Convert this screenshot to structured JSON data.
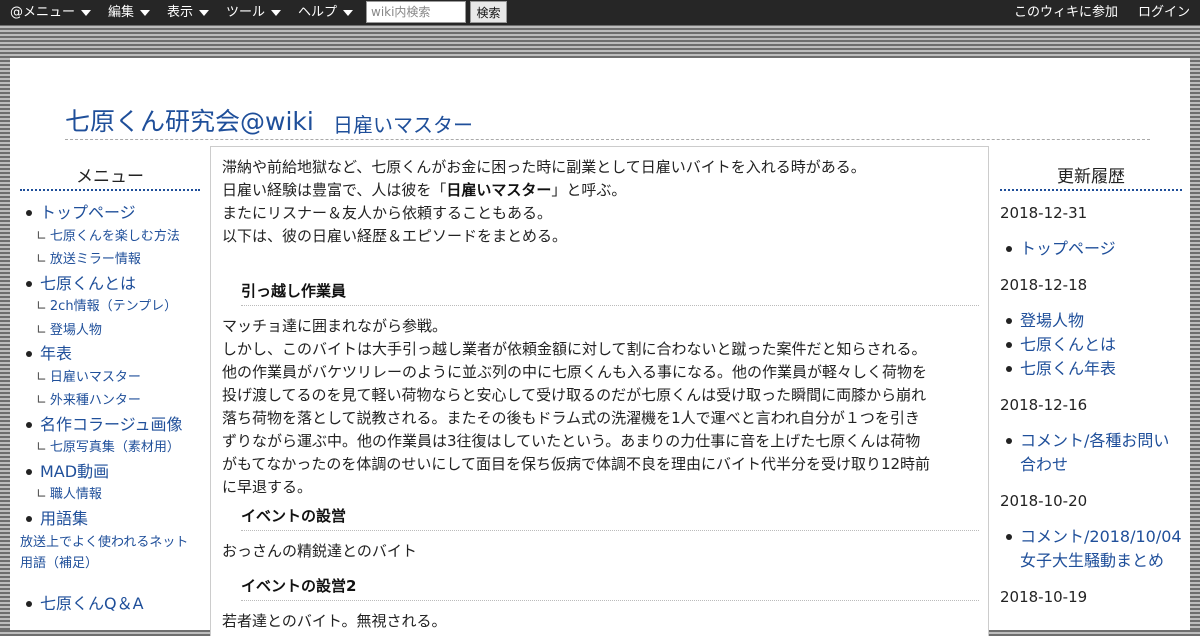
{
  "topbar": {
    "menus": [
      "@メニュー",
      "編集",
      "表示",
      "ツール",
      "ヘルプ"
    ],
    "search_placeholder": "wiki内検索",
    "search_button": "検索",
    "join_link": "このウィキに参加",
    "login_link": "ログイン"
  },
  "header": {
    "site_title": "七原くん研究会@wiki",
    "page_title": "日雇いマスター"
  },
  "left_menu": {
    "heading": "メニュー",
    "items": [
      {
        "level": 1,
        "label": "トップページ"
      },
      {
        "level": 2,
        "label": "七原くんを楽しむ方法"
      },
      {
        "level": 2,
        "label": "放送ミラー情報"
      },
      {
        "level": 1,
        "label": "七原くんとは"
      },
      {
        "level": 2,
        "label": "2ch情報（テンプレ）"
      },
      {
        "level": 2,
        "label": "登場人物"
      },
      {
        "level": 1,
        "label": "年表"
      },
      {
        "level": 2,
        "label": "日雇いマスター"
      },
      {
        "level": 2,
        "label": "外来種ハンター"
      },
      {
        "level": 1,
        "label": "名作コラージュ画像"
      },
      {
        "level": 2,
        "label": "七原写真集（素材用）"
      },
      {
        "level": 1,
        "label": "MAD動画"
      },
      {
        "level": 2,
        "label": "職人情報"
      },
      {
        "level": 1,
        "label": "用語集"
      },
      {
        "level": 0,
        "label": "放送上でよく使われるネット用語（補足）"
      },
      {
        "level": 1,
        "label": "七原くんQ＆A"
      }
    ],
    "branch_glyph": "∟"
  },
  "content": {
    "intro": {
      "line1": "滞納や前給地獄など、七原くんがお金に困った時に副業として日雇いバイトを入れる時がある。",
      "line2_pre": "日雇い経験は豊富で、人は彼を「",
      "line2_bold": "日雇いマスター",
      "line2_post": "」と呼ぶ。",
      "line3": "またにリスナー＆友人から依頼することもある。",
      "line4": "以下は、彼の日雇い経歴＆エピソードをまとめる。"
    },
    "sections": [
      {
        "heading": "引っ越し作業員",
        "lines": [
          "マッチョ達に囲まれながら参戦。",
          "しかし、このバイトは大手引っ越し業者が依頼金額に対して割に合わないと蹴った案件だと知らされる。",
          "他の作業員がバケツリレーのように並ぶ列の中に七原くんも入る事になる。他の作業員が軽々しく荷物を",
          "投げ渡してるのを見て軽い荷物ならと安心して受け取るのだが七原くんは受け取った瞬間に両膝から崩れ",
          "落ち荷物を落として説教される。またその後もドラム式の洗濯機を1人で運べと言われ自分が１つを引き",
          "ずりながら運ぶ中。他の作業員は3往復はしていたという。あまりの力仕事に音を上げた七原くんは荷物",
          "がもてなかったのを体調のせいにして面目を保ち仮病で体調不良を理由にバイト代半分を受け取り12時前",
          "に早退する。"
        ]
      },
      {
        "heading": "イベントの設営",
        "lines": [
          "おっさんの精鋭達とのバイト"
        ]
      },
      {
        "heading": "イベントの設営2",
        "lines": [
          "若者達とのバイト。無視される。"
        ]
      }
    ]
  },
  "right_menu": {
    "heading": "更新履歴",
    "groups": [
      {
        "date": "2018-12-31",
        "items": [
          "トップページ"
        ]
      },
      {
        "date": "2018-12-18",
        "items": [
          "登場人物",
          "七原くんとは",
          "七原くん年表"
        ]
      },
      {
        "date": "2018-12-16",
        "items": [
          "コメント/各種お問い合わせ"
        ]
      },
      {
        "date": "2018-10-20",
        "items": [
          "コメント/2018/10/04 女子大生騒動まとめ"
        ]
      },
      {
        "date": "2018-10-19",
        "items": []
      }
    ]
  }
}
